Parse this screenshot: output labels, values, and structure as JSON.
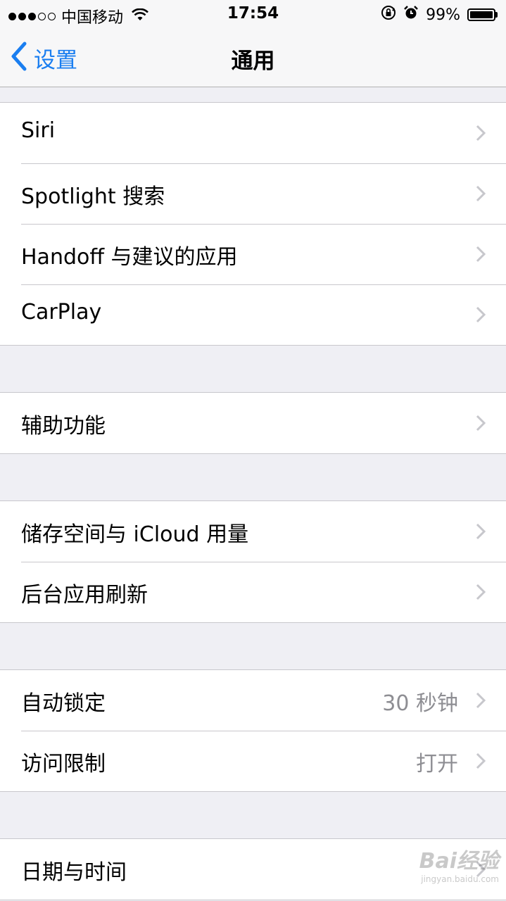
{
  "status_bar": {
    "signal_bars_filled": 3,
    "signal_bars_total": 5,
    "carrier": "中国移动",
    "time": "17:54",
    "battery": "99%",
    "battery_level": 0.99
  },
  "nav": {
    "back_label": "设置",
    "title": "通用"
  },
  "groups": [
    {
      "items": [
        {
          "label": "Siri"
        },
        {
          "label": "Spotlight 搜索"
        },
        {
          "label": "Handoff 与建议的应用"
        },
        {
          "label": "CarPlay"
        }
      ]
    },
    {
      "items": [
        {
          "label": "辅助功能"
        }
      ]
    },
    {
      "items": [
        {
          "label": "储存空间与 iCloud 用量"
        },
        {
          "label": "后台应用刷新"
        }
      ]
    },
    {
      "items": [
        {
          "label": "自动锁定",
          "value": "30 秒钟"
        },
        {
          "label": "访问限制",
          "value": "打开"
        }
      ]
    },
    {
      "items": [
        {
          "label": "日期与时间"
        }
      ]
    }
  ],
  "watermark": {
    "text": "Bai经验",
    "url": "jingyan.baidu.com"
  },
  "colors": {
    "accent": "#1a7ef0",
    "background": "#efeff4",
    "secondary_text": "#8e8e93"
  }
}
